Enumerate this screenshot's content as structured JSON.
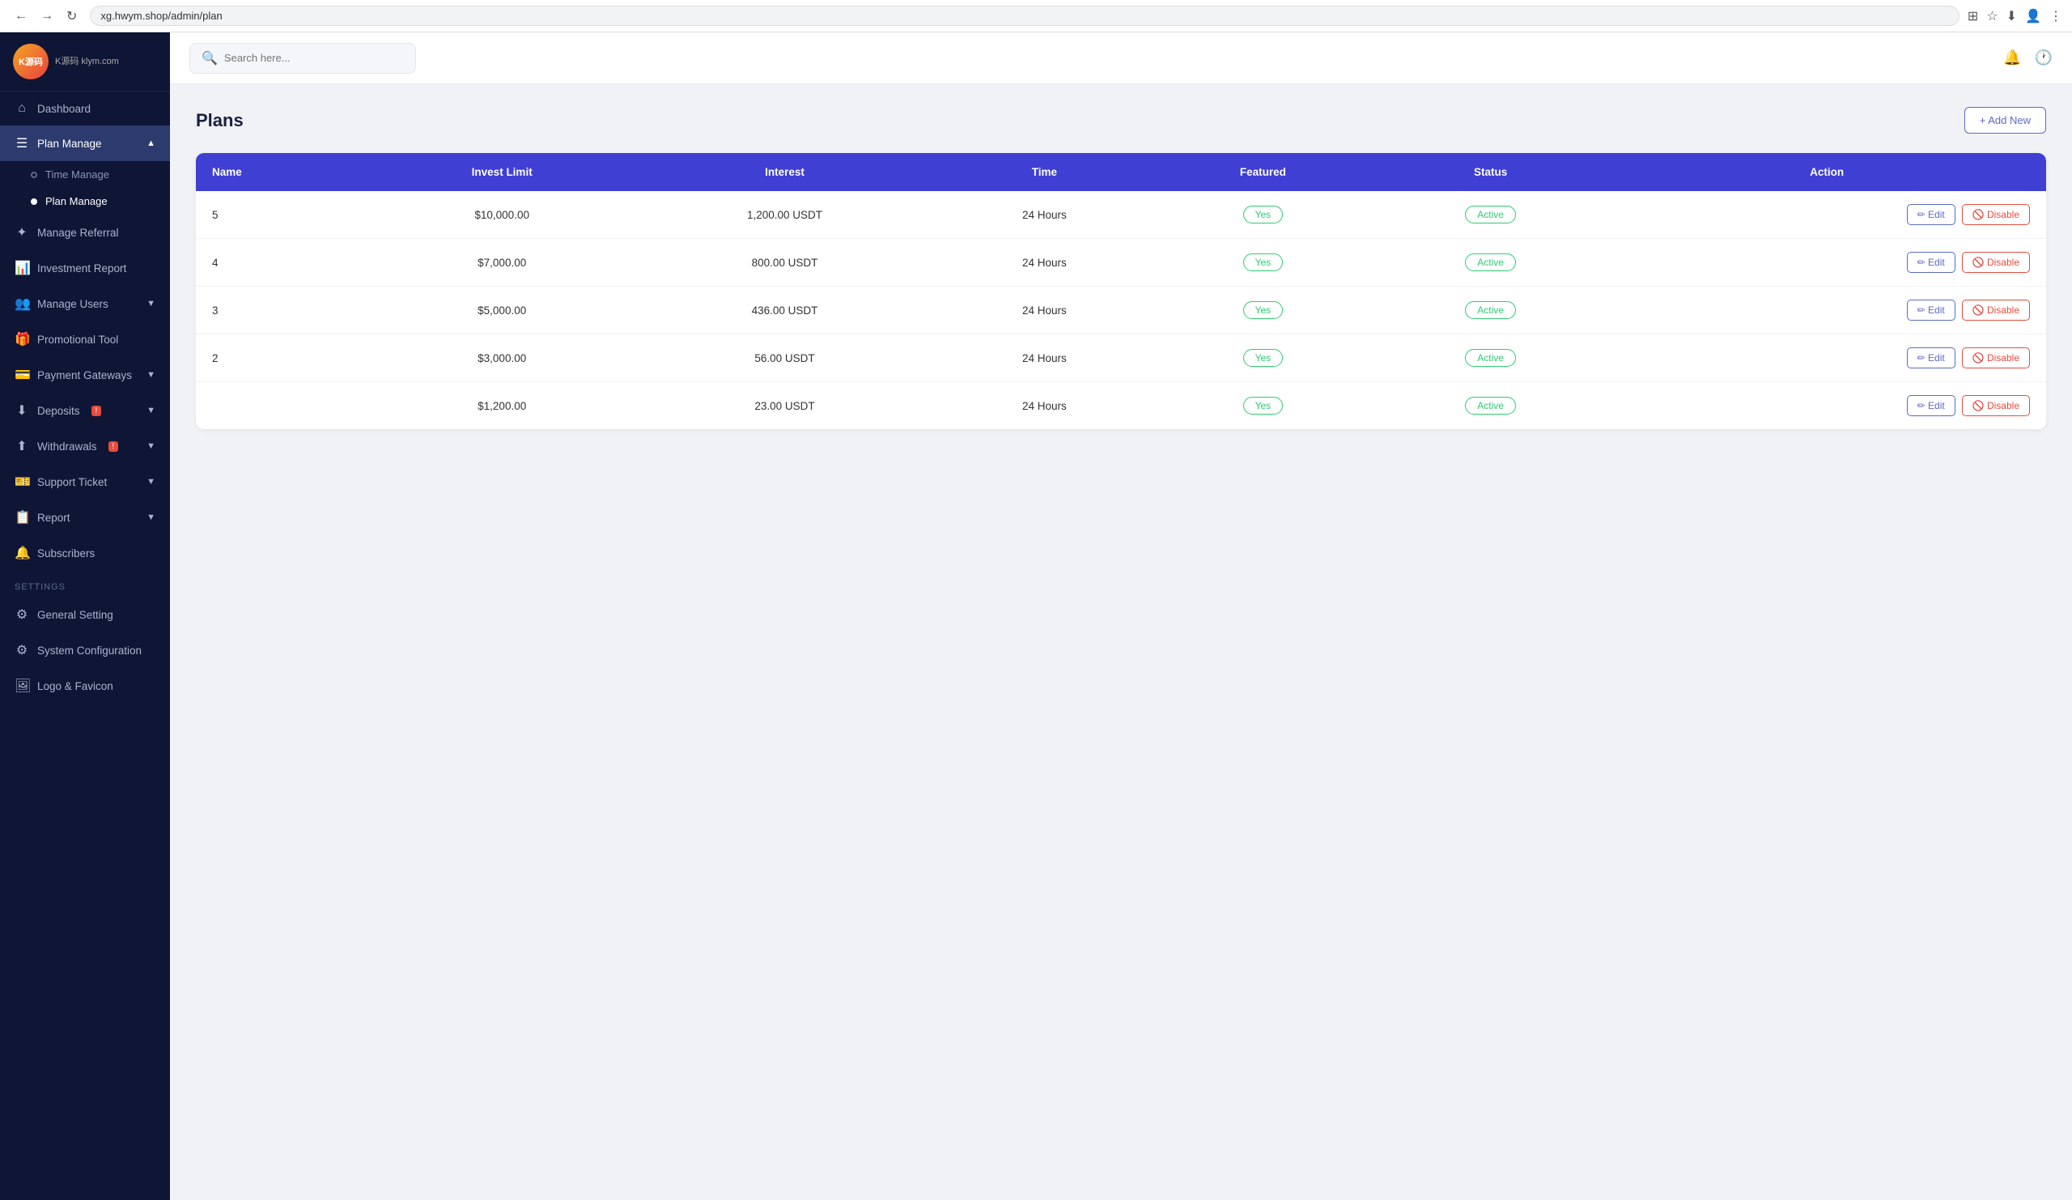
{
  "browser": {
    "url": "xg.hwym.shop/admin/plan",
    "back_label": "←",
    "forward_label": "→",
    "refresh_label": "↻"
  },
  "sidebar": {
    "logo_text": "K源码\nklym.com",
    "nav_items": [
      {
        "id": "dashboard",
        "label": "Dashboard",
        "icon": "⌂",
        "active": false
      },
      {
        "id": "plan-manage",
        "label": "Plan Manage",
        "icon": "☰",
        "active": true,
        "expanded": true,
        "arrow": "▲"
      },
      {
        "id": "time-manage",
        "label": "Time Manage",
        "icon": "",
        "sub": true,
        "active": false
      },
      {
        "id": "plan-manage-sub",
        "label": "Plan Manage",
        "icon": "",
        "sub": true,
        "active": true
      },
      {
        "id": "manage-referral",
        "label": "Manage Referral",
        "icon": "✦",
        "active": false
      },
      {
        "id": "investment-report",
        "label": "Investment Report",
        "icon": "📊",
        "active": false
      },
      {
        "id": "manage-users",
        "label": "Manage Users",
        "icon": "👥",
        "active": false,
        "arrow": "▼"
      },
      {
        "id": "promotional-tool",
        "label": "Promotional Tool",
        "icon": "🎁",
        "active": false
      },
      {
        "id": "payment-gateways",
        "label": "Payment Gateways",
        "icon": "💳",
        "active": false,
        "arrow": "▼"
      },
      {
        "id": "deposits",
        "label": "Deposits",
        "icon": "⬇",
        "active": false,
        "badge": "!",
        "arrow": "▼"
      },
      {
        "id": "withdrawals",
        "label": "Withdrawals",
        "icon": "⬆",
        "active": false,
        "badge": "!",
        "arrow": "▼"
      },
      {
        "id": "support-ticket",
        "label": "Support Ticket",
        "icon": "🎫",
        "active": false,
        "arrow": "▼"
      },
      {
        "id": "report",
        "label": "Report",
        "icon": "📋",
        "active": false,
        "arrow": "▼"
      },
      {
        "id": "subscribers",
        "label": "Subscribers",
        "icon": "🔔",
        "active": false
      }
    ],
    "settings_label": "SETTINGS",
    "settings_items": [
      {
        "id": "general-setting",
        "label": "General Setting",
        "icon": "⚙"
      },
      {
        "id": "system-configuration",
        "label": "System Configuration",
        "icon": "⚙"
      },
      {
        "id": "logo-favicon",
        "label": "Logo & Favicon",
        "icon": "🖼"
      }
    ]
  },
  "topbar": {
    "search_placeholder": "Search here...",
    "bell_icon": "🔔",
    "clock_icon": "🕐"
  },
  "page": {
    "title": "Plans",
    "add_button_label": "+ Add New"
  },
  "table": {
    "headers": [
      "Name",
      "Invest Limit",
      "Interest",
      "Time",
      "Featured",
      "Status",
      "Action"
    ],
    "rows": [
      {
        "name": "5",
        "invest_limit": "$10,000.00",
        "interest": "1,200.00 USDT",
        "time": "24 Hours",
        "featured": "Yes",
        "status": "Active"
      },
      {
        "name": "4",
        "invest_limit": "$7,000.00",
        "interest": "800.00 USDT",
        "time": "24 Hours",
        "featured": "Yes",
        "status": "Active"
      },
      {
        "name": "3",
        "invest_limit": "$5,000.00",
        "interest": "436.00 USDT",
        "time": "24 Hours",
        "featured": "Yes",
        "status": "Active"
      },
      {
        "name": "2",
        "invest_limit": "$3,000.00",
        "interest": "56.00 USDT",
        "time": "24 Hours",
        "featured": "Yes",
        "status": "Active"
      },
      {
        "name": "",
        "invest_limit": "$1,200.00",
        "interest": "23.00 USDT",
        "time": "24 Hours",
        "featured": "Yes",
        "status": "Active"
      }
    ],
    "edit_label": "Edit",
    "disable_label": "Disable"
  }
}
